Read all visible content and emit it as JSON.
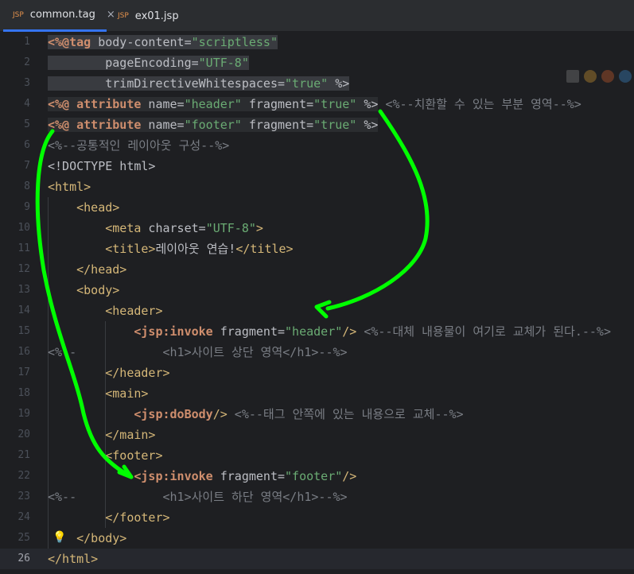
{
  "tabs": [
    {
      "label": "common.tag",
      "icon": "JSP",
      "active": true,
      "close": "×"
    },
    {
      "label": "ex01.jsp",
      "icon": "JSP",
      "active": false
    }
  ],
  "editor": {
    "current_line": 26,
    "line_numbers": [
      "1",
      "2",
      "3",
      "4",
      "5",
      "6",
      "7",
      "8",
      "9",
      "10",
      "11",
      "12",
      "13",
      "14",
      "15",
      "16",
      "17",
      "18",
      "19",
      "20",
      "21",
      "22",
      "23",
      "24",
      "25",
      "26"
    ],
    "lines": [
      {
        "n": 1,
        "segs": [
          [
            "kw",
            "<%@tag"
          ],
          [
            "plain",
            " body-content="
          ],
          [
            "str",
            "\"scriptless\""
          ]
        ]
      },
      {
        "n": 2,
        "segs": [
          [
            "plain",
            "        pageEncoding="
          ],
          [
            "str",
            "\"UTF-8\""
          ]
        ]
      },
      {
        "n": 3,
        "segs": [
          [
            "plain",
            "        trimDirectiveWhitespaces="
          ],
          [
            "str",
            "\"true\""
          ],
          [
            "plain",
            " %>"
          ]
        ]
      },
      {
        "n": 4,
        "segs": [
          [
            "kw",
            "<%@ attribute"
          ],
          [
            "plain",
            " name="
          ],
          [
            "str",
            "\"header\""
          ],
          [
            "plain",
            " fragment="
          ],
          [
            "str",
            "\"true\""
          ],
          [
            "plain",
            " %>"
          ],
          [
            "cm",
            " <%--치환할 수 있는 부분 영역--%>"
          ]
        ]
      },
      {
        "n": 5,
        "segs": [
          [
            "kw",
            "<%@ attribute"
          ],
          [
            "plain",
            " name="
          ],
          [
            "str",
            "\"footer\""
          ],
          [
            "plain",
            " fragment="
          ],
          [
            "str",
            "\"true\""
          ],
          [
            "plain",
            " %>"
          ]
        ]
      },
      {
        "n": 6,
        "segs": [
          [
            "cm",
            "<%--공통적인 레이아웃 구성--%>"
          ]
        ]
      },
      {
        "n": 7,
        "segs": [
          [
            "plain",
            "<!DOCTYPE html>"
          ]
        ]
      },
      {
        "n": 8,
        "segs": [
          [
            "tag",
            "<html>"
          ]
        ]
      },
      {
        "n": 9,
        "segs": [
          [
            "tag",
            "    <head>"
          ]
        ]
      },
      {
        "n": 10,
        "segs": [
          [
            "tag",
            "        <meta"
          ],
          [
            "plain",
            " charset="
          ],
          [
            "str",
            "\"UTF-8\""
          ],
          [
            "tag",
            ">"
          ]
        ]
      },
      {
        "n": 11,
        "segs": [
          [
            "tag",
            "        <title>"
          ],
          [
            "plain",
            "레이아웃 연습!"
          ],
          [
            "tag",
            "</title>"
          ]
        ]
      },
      {
        "n": 12,
        "segs": [
          [
            "tag",
            "    </head>"
          ]
        ]
      },
      {
        "n": 13,
        "segs": [
          [
            "tag",
            "    <body>"
          ]
        ]
      },
      {
        "n": 14,
        "segs": [
          [
            "tag",
            "        <header>"
          ]
        ]
      },
      {
        "n": 15,
        "segs": [
          [
            "plain",
            "            "
          ],
          [
            "kw",
            "<jsp:invoke"
          ],
          [
            "plain",
            " fragment="
          ],
          [
            "str",
            "\"header\""
          ],
          [
            "tag",
            "/>"
          ],
          [
            "cm",
            " <%--대체 내용물이 여기로 교체가 된다.--%>"
          ]
        ]
      },
      {
        "n": 16,
        "segs": [
          [
            "cm",
            "<%--            <h1>사이트 상단 영역</h1>--%>"
          ]
        ]
      },
      {
        "n": 17,
        "segs": [
          [
            "tag",
            "        </header>"
          ]
        ]
      },
      {
        "n": 18,
        "segs": [
          [
            "tag",
            "        <main>"
          ]
        ]
      },
      {
        "n": 19,
        "segs": [
          [
            "plain",
            "            "
          ],
          [
            "kw",
            "<jsp:doBody"
          ],
          [
            "tag",
            "/>"
          ],
          [
            "cm",
            " <%--태그 안쪽에 있는 내용으로 교체--%>"
          ]
        ]
      },
      {
        "n": 20,
        "segs": [
          [
            "tag",
            "        </main>"
          ]
        ]
      },
      {
        "n": 21,
        "segs": [
          [
            "tag",
            "        <footer>"
          ]
        ]
      },
      {
        "n": 22,
        "segs": [
          [
            "plain",
            "            "
          ],
          [
            "kw",
            "<jsp:invoke"
          ],
          [
            "plain",
            " fragment="
          ],
          [
            "str",
            "\"footer\""
          ],
          [
            "tag",
            "/>"
          ]
        ]
      },
      {
        "n": 23,
        "segs": [
          [
            "cm",
            "<%--            <h1>사이트 하단 영역</h1>--%>"
          ]
        ]
      },
      {
        "n": 24,
        "segs": [
          [
            "tag",
            "        </footer>"
          ]
        ]
      },
      {
        "n": 25,
        "segs": [
          [
            "tag",
            "    </body>"
          ]
        ]
      },
      {
        "n": 26,
        "segs": [
          [
            "tag",
            "</html>"
          ]
        ]
      }
    ]
  },
  "colors": {
    "accent": "#3574f0",
    "arrow": "#00ff00",
    "bg": "#1e1f22",
    "tag": "#d5b778",
    "keyword": "#cf8e6d",
    "string": "#6aab73",
    "comment": "#7a7e85"
  },
  "icons": {
    "bulb": "lightbulb-icon",
    "tab_close": "close-icon",
    "file": "jsp-file-icon"
  }
}
